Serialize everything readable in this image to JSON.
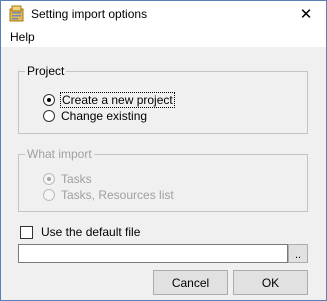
{
  "window": {
    "title": "Setting import options",
    "close_glyph": "✕"
  },
  "menu": {
    "items": [
      "Help"
    ]
  },
  "project_group": {
    "legend": "Project",
    "options": [
      {
        "label": "Create a new project",
        "selected": true
      },
      {
        "label": "Change existing",
        "selected": false
      }
    ]
  },
  "what_import_group": {
    "legend": "What import",
    "disabled": true,
    "options": [
      {
        "label": "Tasks",
        "selected": true
      },
      {
        "label": "Tasks, Resources list",
        "selected": false
      }
    ]
  },
  "default_file": {
    "label": "Use the default file",
    "checked": false
  },
  "file_path": {
    "value": "",
    "browse_label": ".."
  },
  "buttons": {
    "cancel": "Cancel",
    "ok": "OK"
  },
  "icons": {
    "app": "app-icon",
    "close": "close-icon"
  }
}
